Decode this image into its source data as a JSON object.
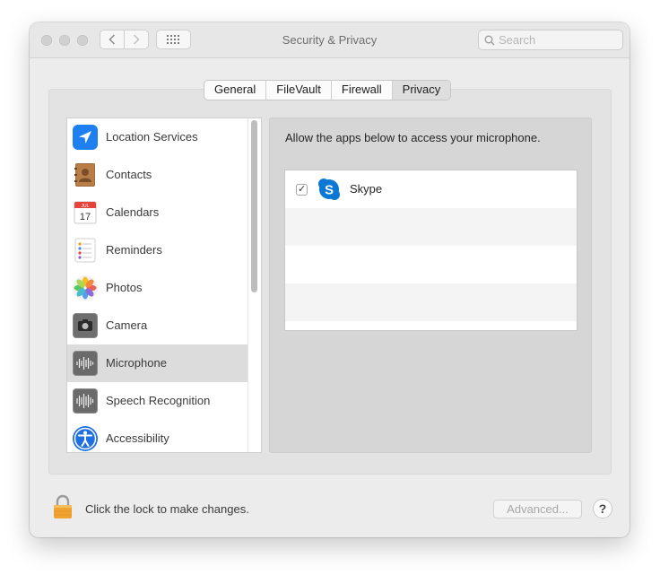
{
  "window": {
    "title": "Security & Privacy"
  },
  "search": {
    "placeholder": "Search"
  },
  "tabs": [
    {
      "label": "General"
    },
    {
      "label": "FileVault"
    },
    {
      "label": "Firewall"
    },
    {
      "label": "Privacy",
      "active": true
    }
  ],
  "sidebar": {
    "items": [
      {
        "label": "Location Services",
        "icon": "location-arrow-icon"
      },
      {
        "label": "Contacts",
        "icon": "contacts-book-icon"
      },
      {
        "label": "Calendars",
        "icon": "calendar-icon",
        "icon_text_month": "JUL",
        "icon_text_day": "17"
      },
      {
        "label": "Reminders",
        "icon": "reminders-list-icon"
      },
      {
        "label": "Photos",
        "icon": "photos-flower-icon"
      },
      {
        "label": "Camera",
        "icon": "camera-icon"
      },
      {
        "label": "Microphone",
        "icon": "microphone-waveform-icon",
        "selected": true
      },
      {
        "label": "Speech Recognition",
        "icon": "speech-waveform-icon"
      },
      {
        "label": "Accessibility",
        "icon": "accessibility-person-icon"
      }
    ]
  },
  "main": {
    "description": "Allow the apps below to access your microphone.",
    "apps": [
      {
        "name": "Skype",
        "checked": true,
        "check_glyph": "✓",
        "icon": "skype-icon",
        "icon_letter": "S"
      }
    ]
  },
  "footer": {
    "lock_text": "Click the lock to make changes.",
    "advanced_label": "Advanced...",
    "help_label": "?"
  },
  "colors": {
    "window_bg": "#ececec",
    "selection": "#dcdcdc",
    "location_blue": "#1e7ff0",
    "skype_blue": "#0a78d4",
    "lock_orange": "#f0a330"
  }
}
